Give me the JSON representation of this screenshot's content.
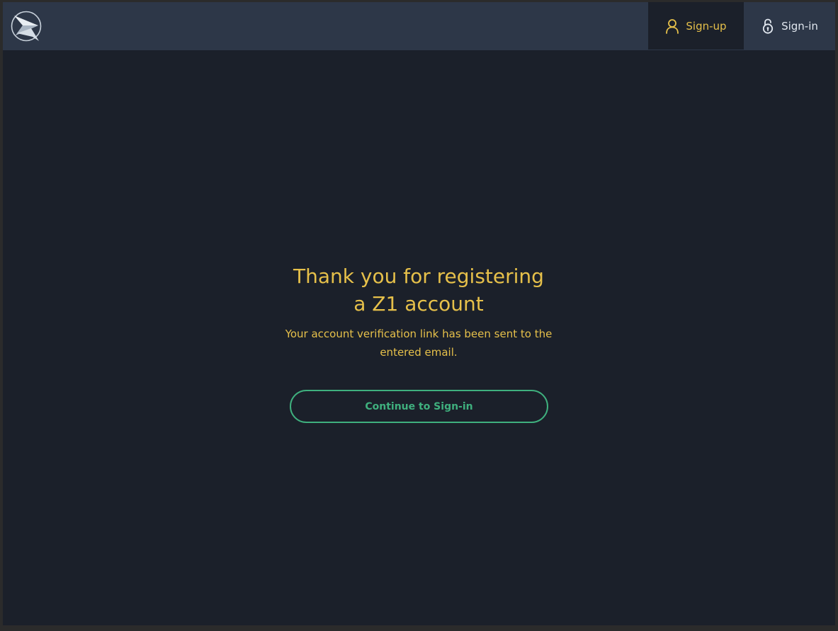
{
  "header": {
    "logo_icon": "z1-logo-icon",
    "nav": {
      "signup": {
        "label": "Sign-up",
        "icon": "user-icon"
      },
      "signin": {
        "label": "Sign-in",
        "icon": "unlock-icon"
      }
    }
  },
  "main": {
    "title_line1": "Thank you for registering",
    "title_line2": "a Z1 account",
    "message_line1": "Your account verification link has been sent to the",
    "message_line2": "entered email.",
    "cta_label": "Continue to Sign-in"
  },
  "colors": {
    "background": "#1b202a",
    "header": "#2d3748",
    "accent_yellow": "#e6c04a",
    "accent_green": "#3fb07e",
    "text_light": "#e2e8f0"
  }
}
